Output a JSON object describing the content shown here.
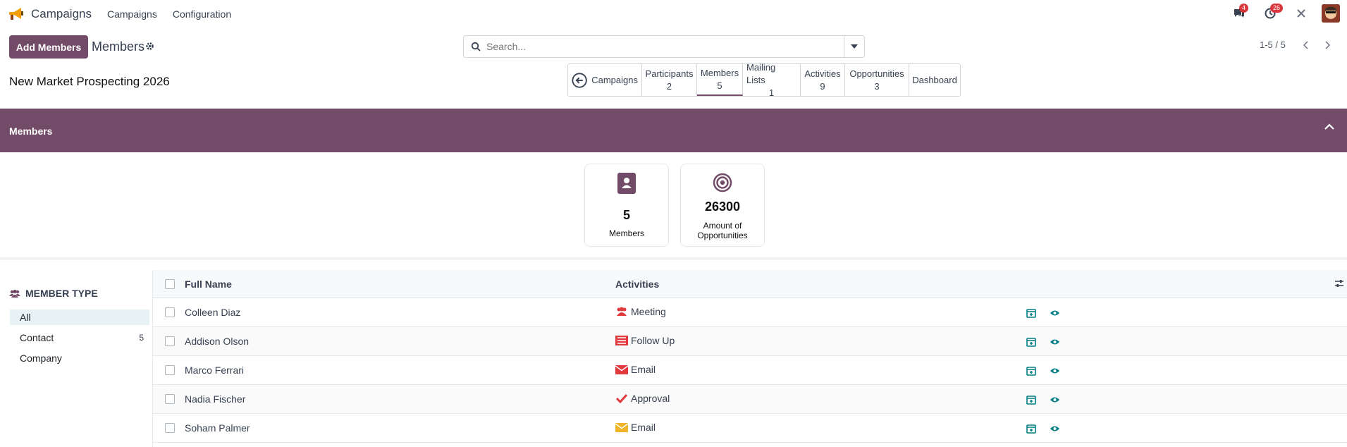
{
  "app": {
    "name": "Campaigns",
    "brand_icon": "megaphone-icon"
  },
  "top_menu": [
    {
      "label": "Campaigns"
    },
    {
      "label": "Configuration"
    }
  ],
  "systray": {
    "messages_badge": "4",
    "activities_badge": "26"
  },
  "control_panel": {
    "add_button": "Add Members",
    "breadcrumb": "Members",
    "search_placeholder": "Search...",
    "pager": "1-5 / 5"
  },
  "record": {
    "title": "New Market Prospecting 2026"
  },
  "smart_buttons": {
    "back": "Campaigns",
    "participants": {
      "label": "Participants",
      "count": "2"
    },
    "members": {
      "label": "Members",
      "count": "5"
    },
    "mailing_lists": {
      "label": "Mailing Lists",
      "count": "1"
    },
    "activities": {
      "label": "Activities",
      "count": "9"
    },
    "opportunities": {
      "label": "Opportunities",
      "count": "3"
    },
    "dashboard": "Dashboard"
  },
  "section": {
    "title": "Members"
  },
  "stats": {
    "members": {
      "value": "5",
      "label": "Members"
    },
    "opportunities": {
      "value": "26300",
      "label_line1": "Amount of",
      "label_line2": "Opportunities"
    }
  },
  "side_panel": {
    "heading": "MEMBER TYPE",
    "items": [
      {
        "label": "All",
        "count": ""
      },
      {
        "label": "Contact",
        "count": "5"
      },
      {
        "label": "Company",
        "count": ""
      }
    ]
  },
  "list": {
    "columns": {
      "name": "Full Name",
      "activities": "Activities"
    },
    "rows": [
      {
        "name": "Colleen Diaz",
        "activity": "Meeting",
        "activity_icon": "users-icon"
      },
      {
        "name": "Addison Olson",
        "activity": "Follow Up",
        "activity_icon": "list-icon"
      },
      {
        "name": "Marco Ferrari",
        "activity": "Email",
        "activity_icon": "envelope-icon"
      },
      {
        "name": "Nadia Fischer",
        "activity": "Approval",
        "activity_icon": "check-icon"
      },
      {
        "name": "Soham Palmer",
        "activity": "Email",
        "activity_icon": "envelope-icon"
      }
    ]
  },
  "colors": {
    "brand": "#714b67",
    "accent_teal": "#017e84",
    "danger": "#d9363e"
  }
}
